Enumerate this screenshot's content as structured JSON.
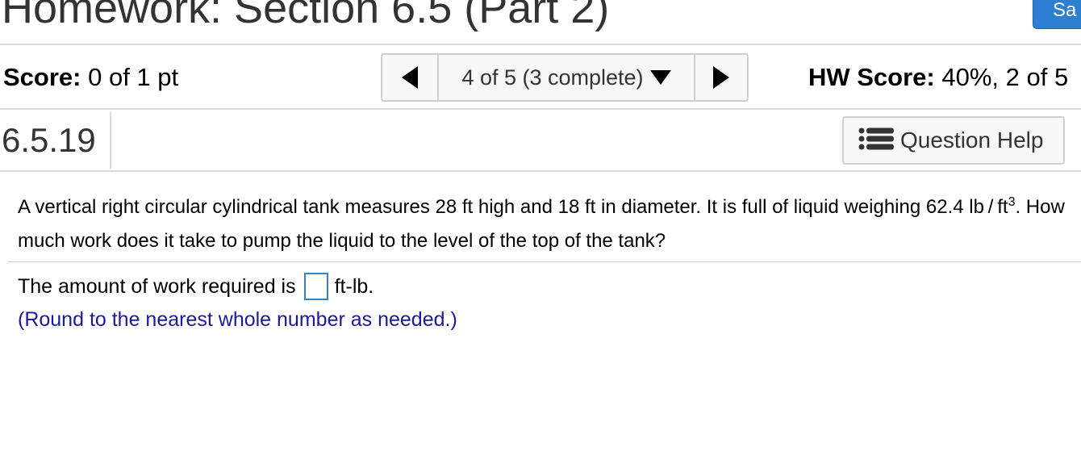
{
  "header": {
    "title": "Homework: Section 6.5 (Part 2)",
    "save_label": "Sa"
  },
  "status_bar": {
    "score_label": "Score:",
    "score_value": " 0 of 1 pt",
    "nav_text": "4 of 5 (3 complete)",
    "hw_score_label": "HW Score:",
    "hw_score_value": " 40%, 2 of 5"
  },
  "question": {
    "number": "6.5.19",
    "help_label": "Question Help",
    "text_part1": "A vertical right circular cylindrical tank measures 28 ft high and 18 ft in diameter. It is full of liquid weighing 62.4 lb / ft",
    "text_sup": "3",
    "text_part2": ". How much work does it take to pump the liquid to the level of the top of the tank?"
  },
  "answer": {
    "prefix": "The amount of work required is",
    "value": "",
    "unit": "ft-lb.",
    "note": "(Round to the nearest whole number as needed.)"
  },
  "colors": {
    "accent": "#2f7fd1",
    "note_text": "#1a1a9c",
    "input_border": "#3a7fc1"
  },
  "icons": {
    "prev": "triangle-left-icon",
    "next": "triangle-right-icon",
    "dropdown": "caret-down-icon",
    "help": "list-icon"
  }
}
